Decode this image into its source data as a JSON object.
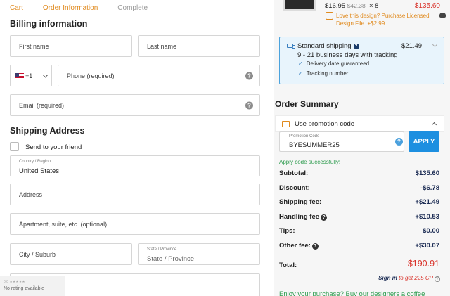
{
  "breadcrumb": {
    "cart": "Cart",
    "order_info": "Order Information",
    "complete": "Complete"
  },
  "billing": {
    "title": "Billing information",
    "first_name_placeholder": "First name",
    "last_name_placeholder": "Last name",
    "country_code": "+1",
    "phone_placeholder": "Phone (required)",
    "email_placeholder": "Email (required)"
  },
  "shipping_address": {
    "title": "Shipping Address",
    "send_to_friend_label": "Send to your friend",
    "country_label": "Country / Region",
    "country_value": "United States",
    "address_placeholder": "Address",
    "apartment_placeholder": "Apartment, suite, etc. (optional)",
    "city_placeholder": "City / Suburb",
    "state_label": "State / Province",
    "state_placeholder": "State / Province"
  },
  "rating_badge": {
    "score": "0.0 ★★★★★",
    "text": "No rating available"
  },
  "cart_item": {
    "unit_price": "$16.95",
    "original_price": "$42.38",
    "quantity": "× 8",
    "line_total": "$135.60",
    "design_license_text": "Love this design? Purchase Licensed Design File. +$2.99"
  },
  "shipping_method": {
    "title": "Standard shipping",
    "price": "$21.49",
    "delivery_time": "9 - 21 business days with tracking",
    "features": [
      "Delivery date guaranteed",
      "Tracking number"
    ]
  },
  "order_summary": {
    "title": "Order Summary",
    "promo_toggle_label": "Use promotion code",
    "promo_field_label": "Promotion Code",
    "promo_code": "BYESUMMER25",
    "apply_label": "APPLY",
    "promo_success": "Apply code successfully!",
    "subtotal_label": "Subtotal:",
    "subtotal": "$135.60",
    "discount_label": "Discount:",
    "discount": "-$6.78",
    "shipping_label": "Shipping fee:",
    "shipping": "+$21.49",
    "handling_label": "Handling fee",
    "handling": "+$10.53",
    "tips_label": "Tips:",
    "tips": "$0.00",
    "other_label": "Other fee:",
    "other": "+$30.07",
    "total_label": "Total:",
    "total": "$190.91",
    "signin_label": "Sign in",
    "cp_text": " to get 225 CP",
    "coffee_text": "Enjoy your purchase? Buy our designers a coffee"
  },
  "colors": {
    "accent_orange": "#e08a1e",
    "price_red": "#d9332b",
    "apply_blue": "#1d8fe0",
    "success_green": "#2e9c4f",
    "shipping_box_blue": "#e8f4fc"
  }
}
